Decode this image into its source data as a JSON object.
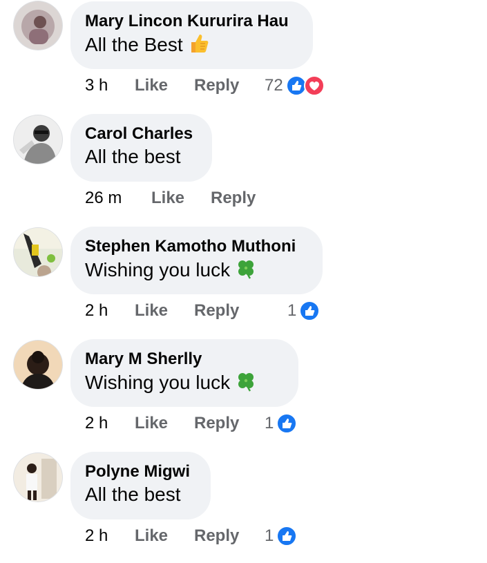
{
  "comments": [
    {
      "name": "Mary Lincon Kururira Hau",
      "text": "All the Best",
      "emoji": "thumbs-up-emoji",
      "time": "3 h",
      "like": "Like",
      "reply": "Reply",
      "reaction_count": "72",
      "reactions": [
        "like",
        "love"
      ],
      "bubble_width": 351
    },
    {
      "name": "Carol Charles",
      "text": "All the best",
      "emoji": "",
      "time": "26 m",
      "like": "Like",
      "reply": "Reply",
      "reaction_count": "",
      "reactions": [],
      "bubble_width": 205
    },
    {
      "name": "Stephen Kamotho Muthoni",
      "text": "Wishing you luck",
      "emoji": "four-leaf-clover-emoji",
      "time": "2 h",
      "like": "Like",
      "reply": "Reply",
      "reaction_count": "1",
      "reactions": [
        "like"
      ],
      "bubble_width": 365
    },
    {
      "name": "Mary M Sherlly",
      "text": "Wishing you luck",
      "emoji": "four-leaf-clover-emoji",
      "time": "2 h",
      "like": "Like",
      "reply": "Reply",
      "reaction_count": "1",
      "reactions": [
        "like"
      ],
      "bubble_width": 330
    },
    {
      "name": "Polyne Migwi",
      "text": "All the best",
      "emoji": "",
      "time": "2 h",
      "like": "Like",
      "reply": "Reply",
      "reaction_count": "1",
      "reactions": [
        "like"
      ],
      "bubble_width": 203
    }
  ],
  "colors": {
    "like_blue": "#1877f2",
    "love_red": "#f33e58",
    "bubble_bg": "#f0f2f5",
    "meta_gray": "#65676b"
  }
}
